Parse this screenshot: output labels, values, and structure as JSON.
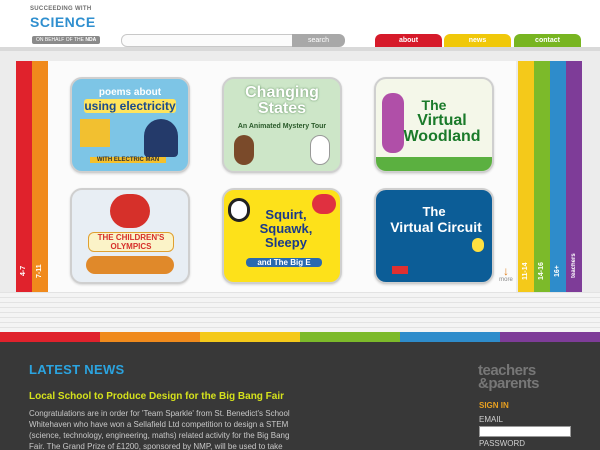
{
  "header": {
    "logo_small": "SUCCEEDING WITH",
    "logo_big": "SCIENCE",
    "behalf_prefix": "ON BEHALF OF THE",
    "behalf_org": "NDA",
    "search_placeholder": "",
    "search_label": "search",
    "nav": [
      {
        "label": "about",
        "color": "#d61a2a"
      },
      {
        "label": "news",
        "color": "#f0c80a"
      },
      {
        "label": "contact",
        "color": "#78b521"
      }
    ]
  },
  "age_tabs_left": [
    {
      "label": "4-7",
      "color": "#e0222c"
    },
    {
      "label": "7-11",
      "color": "#f08a1c"
    }
  ],
  "age_tabs_right": [
    {
      "label": "11-14",
      "color": "#f4c91a"
    },
    {
      "label": "14-16",
      "color": "#7cba2a"
    },
    {
      "label": "16+",
      "color": "#2e8ccb"
    },
    {
      "label": "teachers",
      "color": "#7e3c98"
    }
  ],
  "tiles": [
    {
      "title_top": "poems about",
      "title_main": "using electricity",
      "caption": "WITH ELECTRIC MAN"
    },
    {
      "title_main": "Changing States",
      "subtitle": "An Animated Mystery Tour"
    },
    {
      "title_top": "The",
      "title_main": "Virtual Woodland"
    },
    {
      "title_main": "THE CHILDREN'S OLYMPICS"
    },
    {
      "title_main": "Squirt, Squawk, Sleepy",
      "subtitle": "and The Big E"
    },
    {
      "title_top": "The",
      "title_main": "Virtual Circuit"
    }
  ],
  "more_label": "more",
  "rainbow": [
    "#e0222c",
    "#f08a1c",
    "#f4c91a",
    "#7cba2a",
    "#2e8ccb",
    "#7e3c98"
  ],
  "footer": {
    "news_heading": "LATEST NEWS",
    "news_title": "Local School to Produce Design for the Big Bang Fair",
    "news_body": "Congratulations are in order for 'Team Sparkle' from St. Benedict's School Whitehaven who have won a Sellafield Ltd competition to design a STEM (science, technology, engineering, maths) related activity for the Big Bang Fair. The Grand Prize of £1200, sponsored by NMP, will be used to take",
    "tp_logo_line1": "teachers",
    "tp_logo_line2": "&parents",
    "signin": "SIGN IN",
    "email_label": "EMAIL",
    "password_label": "PASSWORD"
  }
}
